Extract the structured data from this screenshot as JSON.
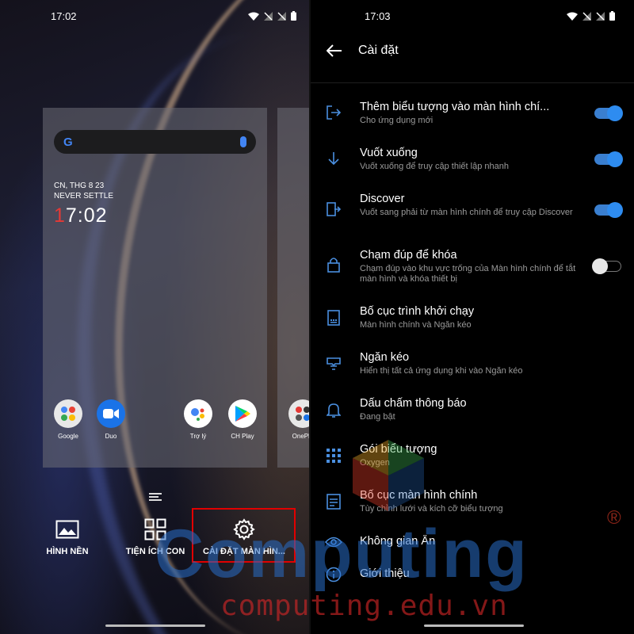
{
  "left": {
    "status_time": "17:02",
    "date_line1": "CN, THG 8 23",
    "date_line2": "NEVER SETTLE",
    "clock_first": "1",
    "clock_rest": "7:02",
    "apps": [
      {
        "label": "Google"
      },
      {
        "label": "Duo"
      },
      {
        "label": "Trợ lý"
      },
      {
        "label": "CH Play"
      },
      {
        "label": "OnePlu"
      }
    ],
    "tools": [
      {
        "label": "HÌNH NỀN",
        "icon": "image-icon"
      },
      {
        "label": "TIỆN ÍCH CON",
        "icon": "widgets-icon"
      },
      {
        "label": "CÀI ĐẶT MÀN HÌN...",
        "icon": "gear-icon"
      }
    ],
    "highlight_color": "#e10000"
  },
  "right": {
    "status_time": "17:03",
    "title": "Cài đặt",
    "accent": "#2e8cf0",
    "items": [
      {
        "title": "Thêm biểu tượng vào màn hình chí...",
        "subtitle": "Cho ứng dụng mới",
        "icon": "add-to-home-icon",
        "toggle": true
      },
      {
        "title": "Vuốt xuống",
        "subtitle": "Vuốt xuống để truy cập thiết lập nhanh",
        "icon": "arrow-down-icon",
        "toggle": true
      },
      {
        "title": "Discover",
        "subtitle": "Vuốt sang phải từ màn hình chính để truy cập Discover",
        "icon": "discover-icon",
        "toggle": true
      },
      {
        "title": "Chạm đúp để khóa",
        "subtitle": "Chạm đúp vào khu vực trống của Màn hình chính để tắt màn hình và khóa thiết bị",
        "icon": "lock-icon",
        "toggle": false
      },
      {
        "title": "Bố cục trình khởi chạy",
        "subtitle": "Màn hình chính và Ngăn kéo",
        "icon": "phone-layout-icon",
        "toggle": null
      },
      {
        "title": "Ngăn kéo",
        "subtitle": "Hiển thị tất cả ứng dụng khi vào Ngăn kéo",
        "icon": "drawer-icon",
        "toggle": null
      },
      {
        "title": "Dấu chấm thông báo",
        "subtitle": "Đang bật",
        "icon": "bell-icon",
        "toggle": null
      },
      {
        "title": "Gói biểu tượng",
        "subtitle": "Oxygen",
        "icon": "icon-grid-icon",
        "toggle": null
      },
      {
        "title": "Bố cục màn hình chính",
        "subtitle": "Tùy chỉnh lưới và kích cỡ biểu tượng",
        "icon": "home-layout-icon",
        "toggle": null
      },
      {
        "title": "Không gian Ẩn",
        "subtitle": "",
        "icon": "eye-icon",
        "toggle": null
      },
      {
        "title": "Giới thiệu",
        "subtitle": "",
        "icon": "info-icon",
        "toggle": null
      }
    ]
  },
  "watermark": {
    "brand": "Computing",
    "registered": "®",
    "url": "computing.edu.vn"
  }
}
